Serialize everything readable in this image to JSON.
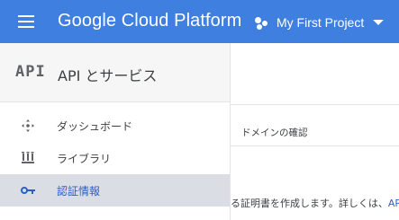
{
  "header": {
    "product_title": "Google Cloud Platform",
    "project_name": "My First Project",
    "colors": {
      "bar": "#3f7fe0",
      "text": "#ffffff"
    },
    "icons": {
      "menu": "hamburger-menu-icon",
      "project": "project-dots-icon",
      "caret": "caret-down-icon"
    }
  },
  "sidebar": {
    "badge": "API",
    "title": "API とサービス",
    "items": [
      {
        "label": "ダッシュボード",
        "icon": "dashboard-icon",
        "active": false
      },
      {
        "label": "ライブラリ",
        "icon": "library-icon",
        "active": false
      },
      {
        "label": "認証情報",
        "icon": "key-icon",
        "active": true
      }
    ],
    "colors": {
      "active_bg": "#dadee4",
      "active_text": "#2b5fc4"
    }
  },
  "main": {
    "column_header": "ドメインの確認",
    "description_text": "る証明書を作成します。詳しくは、",
    "description_link": "API ド"
  }
}
